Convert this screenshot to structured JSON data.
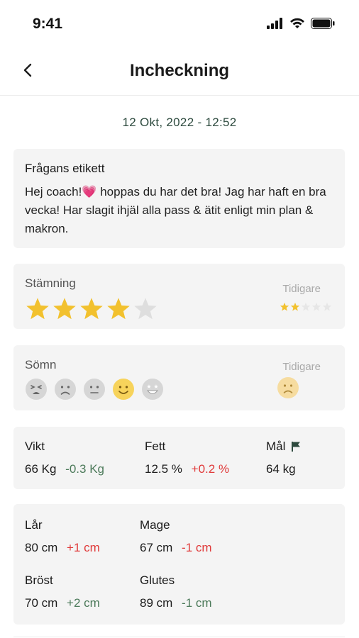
{
  "status": {
    "time": "9:41"
  },
  "nav": {
    "title": "Incheckning"
  },
  "checkin": {
    "date": "12 Okt, 2022 - 12:52"
  },
  "question": {
    "label": "Frågans etikett",
    "text": "Hej coach!💗 hoppas du har det bra! Jag har haft en bra vecka! Har slagit ihjäl alla pass & ätit enligt min plan & makron."
  },
  "mood": {
    "label": "Stämning",
    "previous_label": "Tidigare",
    "rating": 4,
    "max": 5,
    "previous_rating": 2
  },
  "sleep": {
    "label": "Sömn",
    "previous_label": "Tidigare",
    "selected": 4,
    "options": [
      "tired-face-icon",
      "sad-face-icon",
      "neutral-face-icon",
      "smile-face-icon",
      "star-eyes-face-icon"
    ],
    "previous": "sad-face-icon"
  },
  "stats": {
    "weight": {
      "label": "Vikt",
      "value": "66 Kg",
      "delta": "-0.3 Kg"
    },
    "fat": {
      "label": "Fett",
      "value": "12.5 %",
      "delta": "+0.2 %"
    },
    "goal": {
      "label": "Mål",
      "value": "64 kg"
    }
  },
  "measurements": {
    "thigh": {
      "label": "Lår",
      "value": "80 cm",
      "delta": "+1 cm"
    },
    "belly": {
      "label": "Mage",
      "value": "67 cm",
      "delta": "-1 cm"
    },
    "chest": {
      "label": "Bröst",
      "value": "70 cm",
      "delta": "+2 cm"
    },
    "glutes": {
      "label": "Glutes",
      "value": "89 cm",
      "delta": "-1 cm"
    }
  },
  "colors": {
    "star": "#f2c12e",
    "star_empty": "#dedede",
    "accent_green": "#4c7a5a",
    "accent_red": "#e03a3a",
    "face_selected": "#f7d35b",
    "face_muted": "#d6d6d6"
  }
}
